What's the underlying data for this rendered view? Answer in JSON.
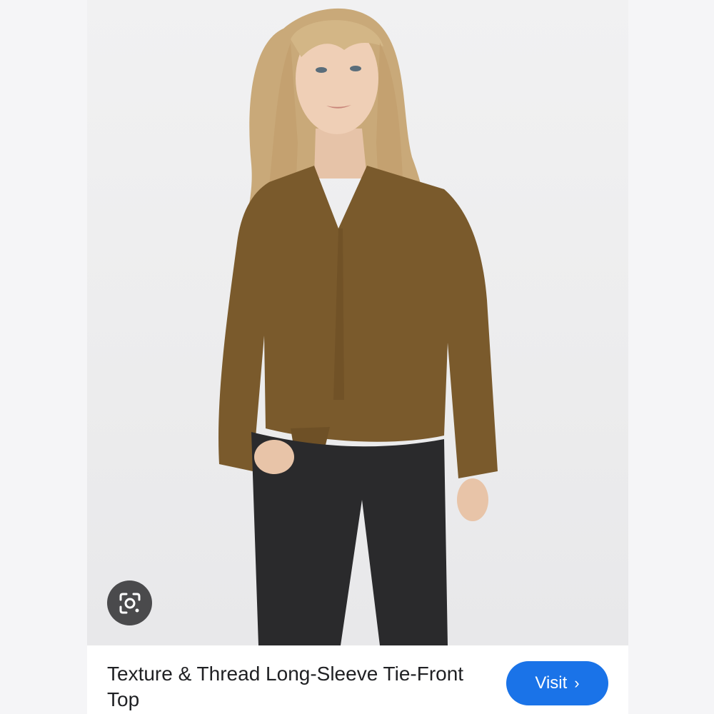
{
  "result": {
    "title": "Texture & Thread Long-Sleeve Tie-Front Top",
    "visit_label": "Visit",
    "visit_icon": "chevron-right-icon"
  },
  "lens": {
    "icon": "google-lens-icon"
  },
  "image": {
    "subject": "product-photo"
  },
  "colors": {
    "accent": "#1a73e8",
    "top": "#7a5a2c",
    "jeans": "#2a2a2c",
    "hair": "#c9a979",
    "lens_button": "#4a4a4c"
  }
}
